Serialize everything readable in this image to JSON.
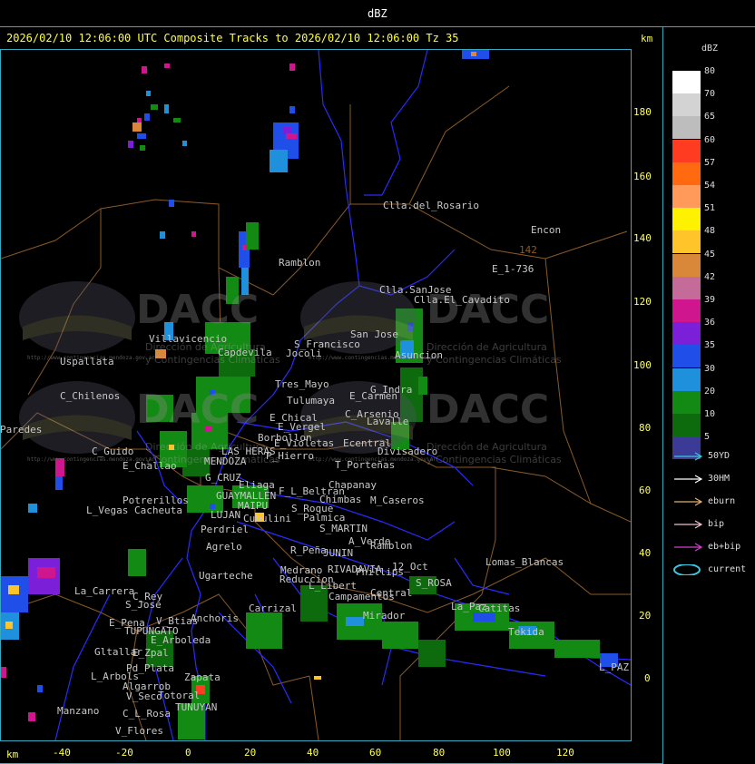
{
  "header": {
    "unit_title": "dBZ"
  },
  "title_line": {
    "text": "2026/02/10 12:06:00 UTC Composite Tracks to 2026/02/10 12:06:00 Tz 35",
    "km_right": "km"
  },
  "axes": {
    "y_ticks": [
      "180",
      "160",
      "140",
      "120",
      "100",
      "80",
      "60",
      "40",
      "20",
      "0"
    ],
    "x_ticks": [
      "-40",
      "-20",
      "0",
      "20",
      "40",
      "60",
      "80",
      "100",
      "120"
    ],
    "x_unit": "km"
  },
  "colorbar": {
    "title": "dBZ",
    "levels": [
      {
        "label": "80",
        "color": "#ffffff"
      },
      {
        "label": "70",
        "color": "#d3d3d3"
      },
      {
        "label": "65",
        "color": "#bdbdbd"
      },
      {
        "label": "60",
        "color": "#ff3b22"
      },
      {
        "label": "57",
        "color": "#ff6a10"
      },
      {
        "label": "54",
        "color": "#ff9a5a"
      },
      {
        "label": "51",
        "color": "#fff200"
      },
      {
        "label": "48",
        "color": "#ffc42a"
      },
      {
        "label": "45",
        "color": "#d9883a"
      },
      {
        "label": "42",
        "color": "#c56b9a"
      },
      {
        "label": "39",
        "color": "#d0168f"
      },
      {
        "label": "36",
        "color": "#7b1fd8"
      },
      {
        "label": "35",
        "color": "#1f4fe8"
      },
      {
        "label": "30",
        "color": "#1e90dc"
      },
      {
        "label": "20",
        "color": "#138a13"
      },
      {
        "label": "10",
        "color": "#0d6a0d"
      },
      {
        "label": "5",
        "color": "#3b3a96"
      }
    ]
  },
  "legend": [
    {
      "label": "50YD",
      "color": "#39c8d8"
    },
    {
      "label": "30HM",
      "color": "#ffffff"
    },
    {
      "label": "eburn",
      "color": "#e0b070"
    },
    {
      "label": "bip",
      "color": "#f0c0d0"
    },
    {
      "label": "eb+bip",
      "color": "#d040d0"
    },
    {
      "label": "current",
      "color": "#3cc8e0"
    }
  ],
  "watermark": {
    "brand": "DACC",
    "line1": "Dirección de Agricultura",
    "line2": "y Contingencias Climáticas",
    "url": "http://www.contingencias.mendoza.gov.ar"
  },
  "places": [
    "Clla.del_Rosario",
    "Encon",
    "142",
    "E_1-736",
    "Ramblon",
    "Clla.SanJose",
    "Clla.El_Cavadito",
    "San Jose",
    "S_Francisco",
    "Villavicencio",
    "Capdevila",
    "Jocoli",
    "Asuncion",
    "Uspallata",
    "Tres_Mayo",
    "E_Carmen",
    "G_Indra",
    "C_Chilenos",
    "Tulumaya",
    "E_Chical",
    "E_Vergel",
    "C_Arsenio",
    "Lavalle",
    "Paredes",
    "Borbollon",
    "E_Violetas",
    "Ecentral",
    "Divisadero",
    "C_Guido",
    "LAS HERAS",
    "P_Hierro",
    "MENDOZA",
    "T_Porteñas",
    "E_Challao",
    "G_CRUZ",
    "Chapanay",
    "Eliaga",
    "F_L_Beltran",
    "Chimbas",
    "M_Caseros",
    "Potrerillos",
    "GUAYMALLEN",
    "MAIPU",
    "L_Vegas",
    "Cacheuta",
    "S_Roque",
    "Palmica",
    "LUJAN",
    "Cubulini",
    "Perdriel",
    "S_MARTIN",
    "A_Verde",
    "Ramblon",
    "Agrelo",
    "R_Peña",
    "JUNIN",
    "Lomas_Blancas",
    "Ugarteche",
    "Medrano",
    "RIVADAVIA",
    "Phillips",
    "12_Oct",
    "Reduccion",
    "S_ROSA",
    "La_Carrera",
    "C_Rey",
    "L_Libert",
    "Campamentos",
    "Central",
    "S_Jose",
    "Carrizal",
    "La_Paz",
    "E_Pena",
    "V_Btias",
    "Anchoris",
    "TUPUNGATO",
    "Mirador",
    "Catitas",
    "Tekida",
    "E_Arboleda",
    "Gltallar",
    "E_Zpal",
    "Pd_Plata",
    "L_Arbols",
    "Zapata",
    "Algarrob",
    "V_Seco",
    "Totoral",
    "TUNUYAN",
    "Manzano",
    "C_L_Rosa",
    "V_Flores",
    "L_PAZ"
  ]
}
